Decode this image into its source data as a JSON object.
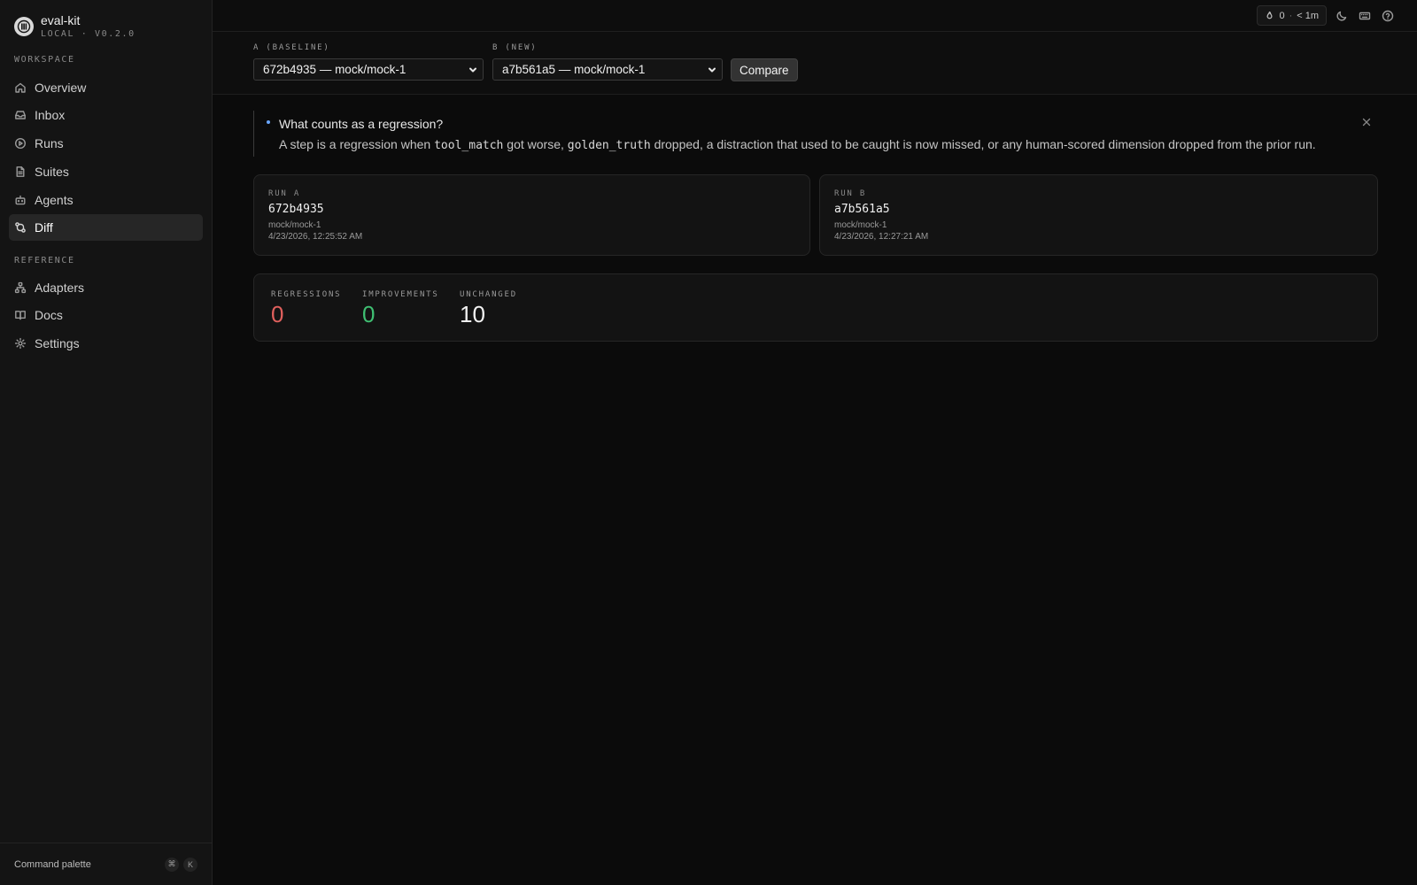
{
  "app": {
    "name": "eval-kit",
    "version": "LOCAL · V0.2.0"
  },
  "sidebar": {
    "workspace_label": "WORKSPACE",
    "reference_label": "REFERENCE",
    "workspace_items": [
      {
        "label": "Overview",
        "icon": "home-icon"
      },
      {
        "label": "Inbox",
        "icon": "inbox-icon"
      },
      {
        "label": "Runs",
        "icon": "play-circle-icon"
      },
      {
        "label": "Suites",
        "icon": "file-icon"
      },
      {
        "label": "Agents",
        "icon": "bot-icon"
      },
      {
        "label": "Diff",
        "icon": "git-compare-icon",
        "active": true
      }
    ],
    "reference_items": [
      {
        "label": "Adapters",
        "icon": "network-icon"
      },
      {
        "label": "Docs",
        "icon": "book-icon"
      },
      {
        "label": "Settings",
        "icon": "gear-icon"
      }
    ],
    "footer": {
      "command_palette": "Command palette",
      "shortcut_keys": [
        "⌘",
        "K"
      ]
    }
  },
  "topbar": {
    "status_count": "0",
    "status_separator": "·",
    "status_time": "< 1m",
    "icons": [
      "flame-icon",
      "moon-icon",
      "keyboard-icon",
      "help-icon"
    ]
  },
  "compare": {
    "a_label": "A (BASELINE)",
    "b_label": "B (NEW)",
    "a_value": "672b4935 — mock/mock-1",
    "b_value": "a7b561a5 — mock/mock-1",
    "button": "Compare"
  },
  "callout": {
    "title": "What counts as a regression?",
    "body_prefix": "A step is a regression when ",
    "code1": "tool_match",
    "body_mid": " got worse, ",
    "code2": "golden_truth",
    "body_suffix": " dropped, a distraction that used to be caught is now missed, or any human-scored dimension dropped from the prior run."
  },
  "runs": {
    "a": {
      "label": "RUN A",
      "id": "672b4935",
      "model": "mock/mock-1",
      "date": "4/23/2026, 12:25:52 AM"
    },
    "b": {
      "label": "RUN B",
      "id": "a7b561a5",
      "model": "mock/mock-1",
      "date": "4/23/2026, 12:27:21 AM"
    }
  },
  "stats": {
    "regressions_label": "REGRESSIONS",
    "regressions": "0",
    "improvements_label": "IMPROVEMENTS",
    "improvements": "0",
    "unchanged_label": "UNCHANGED",
    "unchanged": "10",
    "colors": {
      "regressions": "#e0605d",
      "improvements": "#3fbf72",
      "unchanged": "#f2f2f2"
    }
  }
}
